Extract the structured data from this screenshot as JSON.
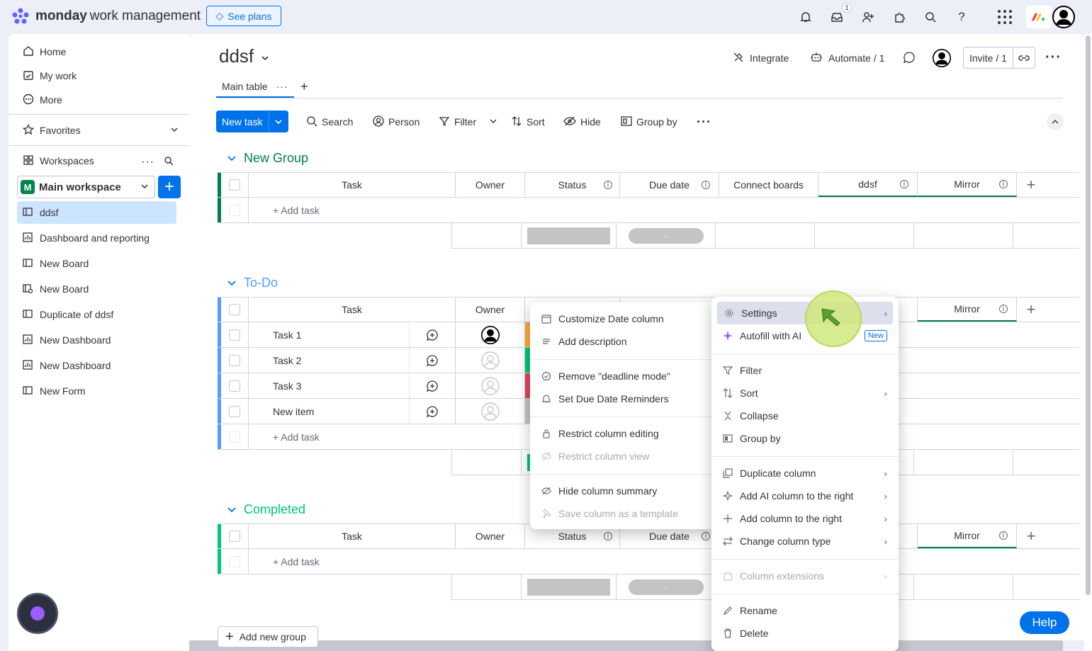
{
  "topbar": {
    "brand_bold": "monday",
    "brand_rest": "work management",
    "see_plans": "See plans",
    "notification_count": "1"
  },
  "sidebar": {
    "nav": [
      {
        "label": "Home",
        "icon": "home-icon"
      },
      {
        "label": "My work",
        "icon": "calendar-check-icon"
      },
      {
        "label": "More",
        "icon": "more-circle-icon"
      }
    ],
    "favorites": "Favorites",
    "workspaces": "Workspaces",
    "workspace_letter": "M",
    "workspace_name": "Main workspace",
    "boards": [
      {
        "label": "ddsf",
        "icon": "board-icon",
        "active": true
      },
      {
        "label": "Dashboard and reporting",
        "icon": "dashboard-icon"
      },
      {
        "label": "New Board",
        "icon": "board-icon"
      },
      {
        "label": "New Board",
        "icon": "board-share-icon"
      },
      {
        "label": "Duplicate of ddsf",
        "icon": "board-icon"
      },
      {
        "label": "New Dashboard",
        "icon": "dashboard-icon"
      },
      {
        "label": "New Dashboard",
        "icon": "dashboard-icon"
      },
      {
        "label": "New Form",
        "icon": "form-icon"
      }
    ]
  },
  "board": {
    "title": "ddsf",
    "integrate": "Integrate",
    "automate": "Automate / 1",
    "invite": "Invite / 1",
    "tab": "Main table",
    "tab_add": "+"
  },
  "toolbar": {
    "new_task": "New task",
    "search": "Search",
    "person": "Person",
    "filter": "Filter",
    "sort": "Sort",
    "hide": "Hide",
    "group_by": "Group by"
  },
  "columns": {
    "task": "Task",
    "owner": "Owner",
    "status": "Status",
    "due_date": "Due date",
    "connect_boards": "Connect boards",
    "ddsf": "ddsf",
    "mirror": "Mirror"
  },
  "groups": [
    {
      "name": "New Group",
      "color": "#037f4c",
      "add_task": "+ Add task"
    },
    {
      "name": "To-Do",
      "color": "#579bfc",
      "add_task": "+ Add task",
      "tasks": [
        "Task 1",
        "Task 2",
        "Task 3",
        "New item"
      ]
    },
    {
      "name": "Completed",
      "color": "#00c875",
      "add_task": "+ Add task"
    }
  ],
  "summary_dash": "-",
  "add_group": "Add new group",
  "column_menu": {
    "items": [
      "Customize Date column",
      "Add description",
      "Remove \"deadline mode\"",
      "Set Due Date Reminders",
      "Restrict column editing",
      "Restrict column view",
      "Hide column summary",
      "Save column as a template"
    ]
  },
  "settings_menu": {
    "items": [
      "Settings",
      "Autofill with AI",
      "Filter",
      "Sort",
      "Collapse",
      "Group by",
      "Duplicate column",
      "Add AI column to the right",
      "Add column to the right",
      "Change column type",
      "Column extensions",
      "Rename",
      "Delete"
    ],
    "new_tag": "New"
  },
  "help": "Help",
  "colors": {
    "primary": "#0073ea",
    "status_orange": "#fdab3d",
    "status_green": "#00c875",
    "status_red": "#e2445c",
    "status_gray": "#c4c4c4"
  }
}
